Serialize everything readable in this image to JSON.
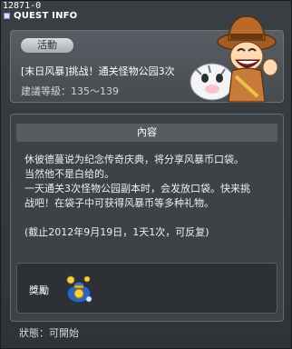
{
  "quest_id": "12871-0",
  "window": {
    "title": "QUEST INFO"
  },
  "header": {
    "badge": "活動",
    "quest_title": "[末日风暴]挑战！通关怪物公园3次",
    "level_requirement": "建議等級：135～139"
  },
  "content": {
    "section_title": "內容",
    "lines": [
      "休彼德蔓说为纪念传奇庆典，将分享风暴币口袋。",
      "当然他不是白给的。",
      "一天通关3次怪物公园副本时，会发放口袋。快来挑",
      "战吧！在袋子中可获得风暴币等多种礼物。"
    ],
    "note": "(截止2012年9月19日，1天1次，可反复)"
  },
  "reward": {
    "label": "獎勵",
    "item_icon": "coin-pouch-icon"
  },
  "status": {
    "text": "狀態：可開始"
  },
  "colors": {
    "accent": "#d6a03a",
    "panel": "#3d4247",
    "text": "#ffffff"
  }
}
